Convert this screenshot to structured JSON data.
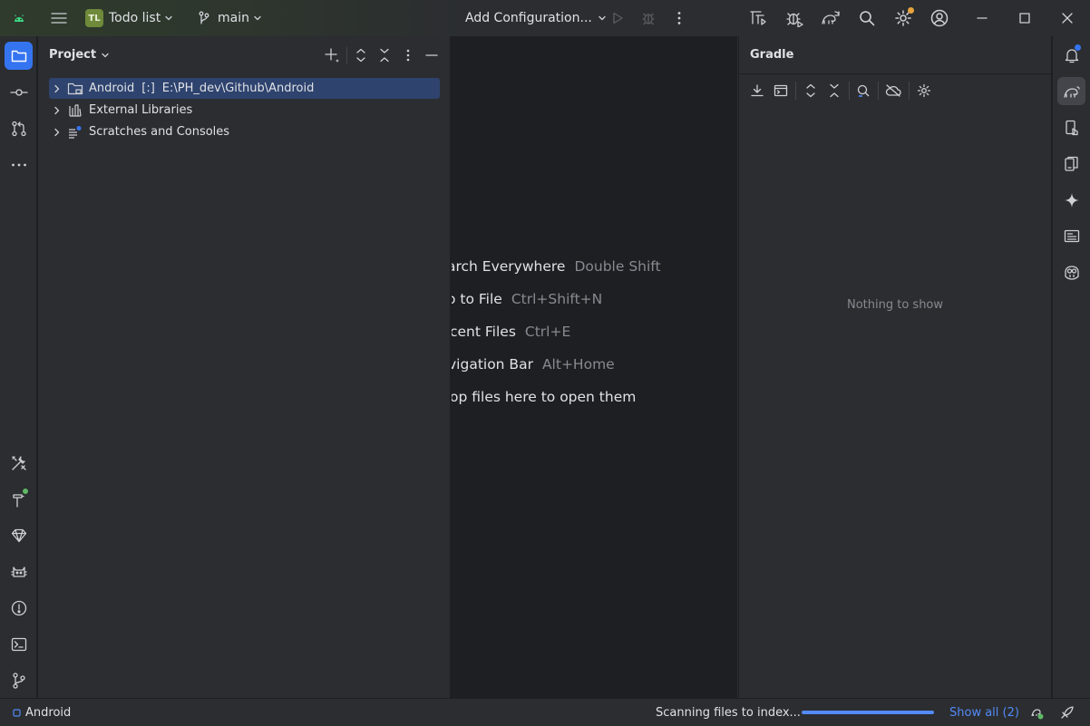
{
  "titlebar": {
    "project_initials": "TL",
    "project_name": "Todo list",
    "branch": "main",
    "run_config": "Add Configuration..."
  },
  "project_panel": {
    "title": "Project",
    "tree": [
      {
        "label": "Android",
        "module_marker": "[:]",
        "path": "E:\\PH_dev\\Github\\Android",
        "selected": true
      },
      {
        "label": "External Libraries",
        "selected": false
      },
      {
        "label": "Scratches and Consoles",
        "selected": false
      }
    ]
  },
  "editor_hints": [
    {
      "action": "arch Everywhere",
      "shortcut": "Double Shift"
    },
    {
      "action": "o to File",
      "shortcut": "Ctrl+Shift+N"
    },
    {
      "action": "cent Files",
      "shortcut": "Ctrl+E"
    },
    {
      "action": "vigation Bar",
      "shortcut": "Alt+Home"
    },
    {
      "action": "op files here to open them",
      "shortcut": ""
    }
  ],
  "gradle_panel": {
    "title": "Gradle",
    "empty_text": "Nothing to show"
  },
  "statusbar": {
    "breadcrumb": "Android",
    "task": "Scanning files to index...",
    "progress": 1.0,
    "show_all": "Show all (2)"
  },
  "colors": {
    "accent": "#3574f0",
    "selection": "#2e436e",
    "badge": "#6e8a3a",
    "notification_dot": "#3574f0",
    "settings_dot": "#e8a33d",
    "ok_dot": "#5fb865"
  },
  "icons": {
    "left_strip_top": [
      "folder-icon",
      "commit-icon",
      "pull-requests-icon",
      "more-icon"
    ],
    "left_strip_bottom": [
      "build-variants-icon",
      "build-icon",
      "gem-icon",
      "logcat-icon",
      "problems-icon",
      "terminal-icon",
      "version-control-icon"
    ],
    "right_strip": [
      "notifications-icon",
      "gradle-icon",
      "device-manager-icon",
      "running-devices-icon",
      "gemini-icon",
      "device-explorer-icon",
      "copilot-icon"
    ]
  }
}
